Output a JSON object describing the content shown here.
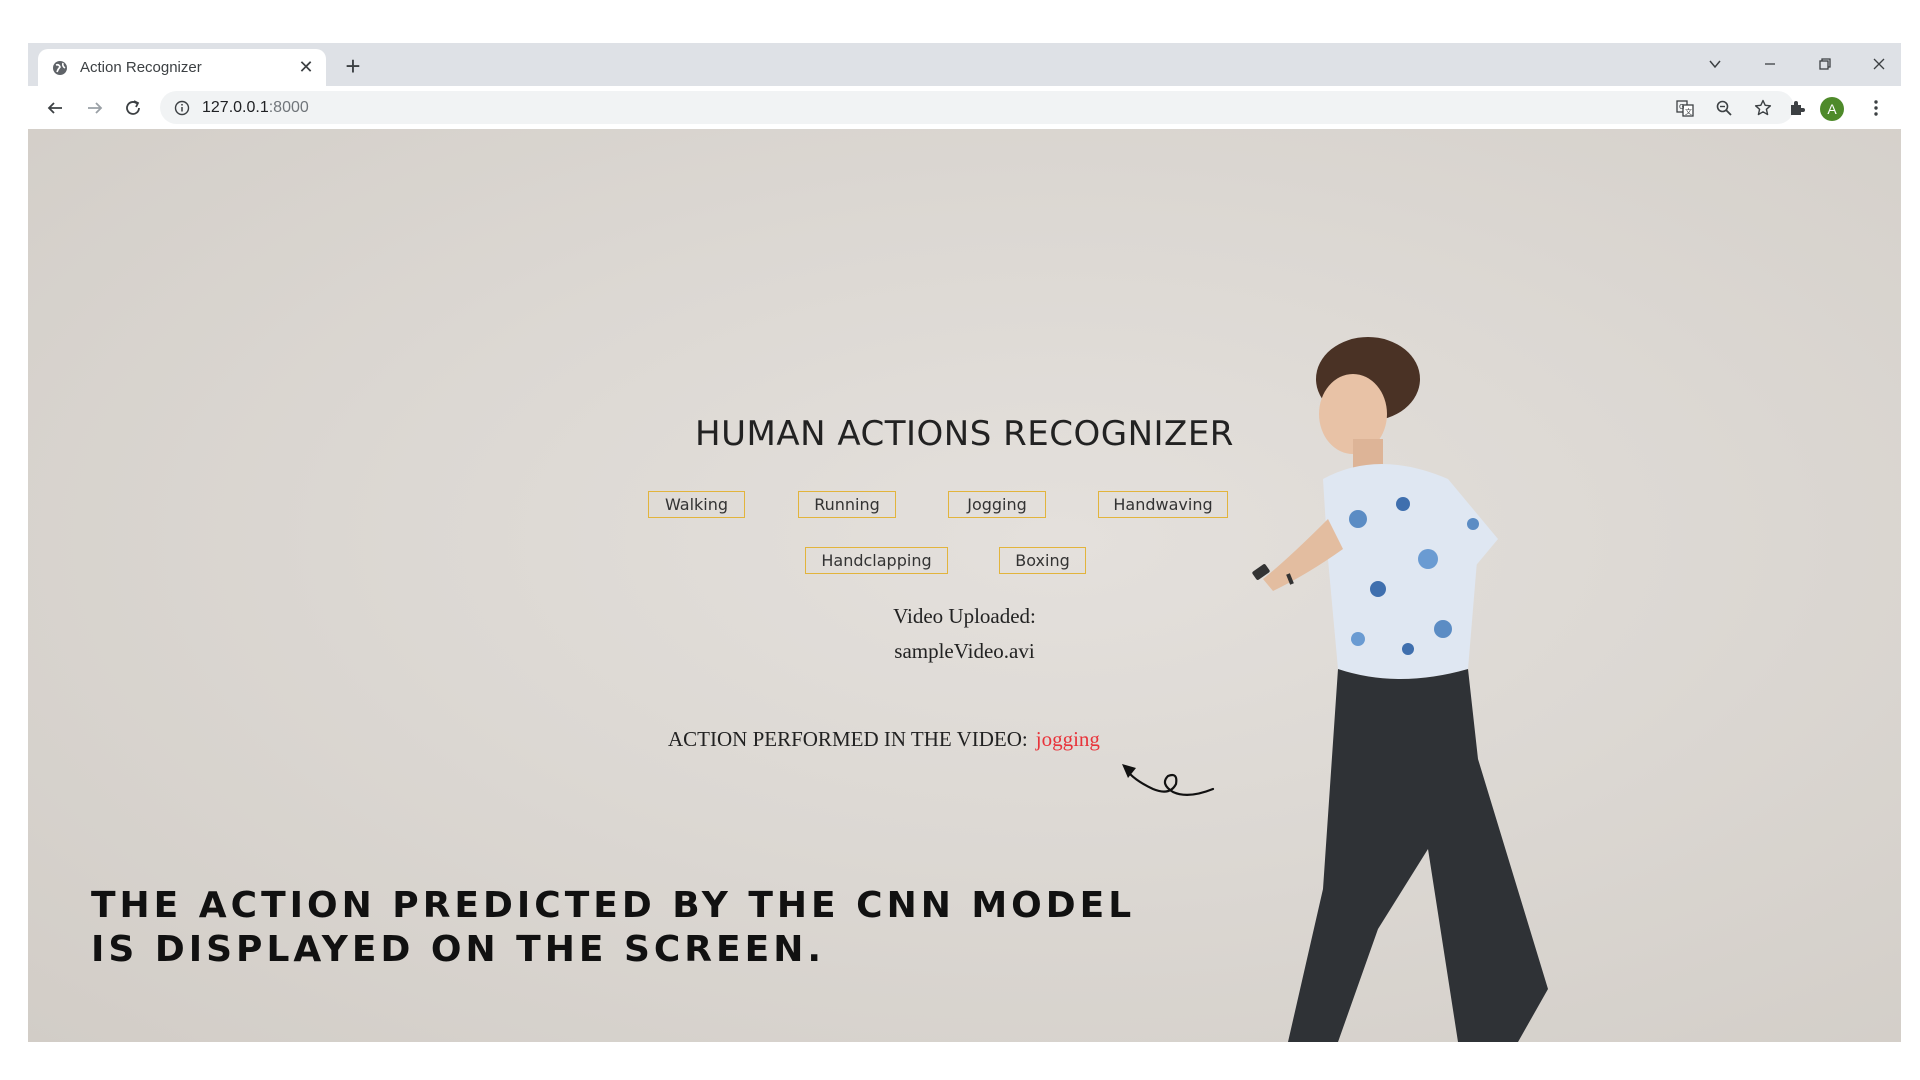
{
  "browser": {
    "tab_title": "Action Recognizer",
    "url_host": "127.0.0.1",
    "url_port": ":8000",
    "profile_initial": "A"
  },
  "page": {
    "heading": "HUMAN ACTIONS RECOGNIZER",
    "actions": [
      "Walking",
      "Running",
      "Jogging",
      "Handwaving",
      "Handclapping",
      "Boxing"
    ],
    "video_uploaded_label": "Video Uploaded:",
    "video_file": "sampleVideo.avi",
    "result_label": "ACTION PERFORMED IN THE VIDEO:",
    "result_value": "jogging",
    "caption_line1": "THE ACTION PREDICTED BY THE CNN MODEL",
    "caption_line2": "IS DISPLAYED ON THE SCREEN."
  },
  "colors": {
    "pill_border": "#e2b43c",
    "prediction": "#e8333a",
    "avatar": "#4e8a2a"
  }
}
